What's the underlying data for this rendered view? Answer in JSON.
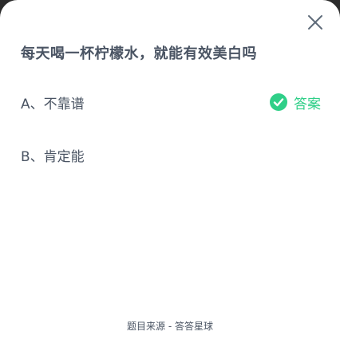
{
  "question": {
    "text": "每天喝一杯柠檬水，就能有效美白吗"
  },
  "options": [
    {
      "label": "A、不靠谱",
      "is_answer": true
    },
    {
      "label": "B、肯定能",
      "is_answer": false
    }
  ],
  "answer_badge": {
    "text": "答案",
    "icon": "check-circle-icon",
    "color": "#2fcf88"
  },
  "close_button": {
    "icon": "close-icon"
  },
  "footer": {
    "source_text": "题目来源 - 答答星球"
  },
  "colors": {
    "text": "#4a5463",
    "accent": "#2fcf88",
    "background": "#ffffff"
  }
}
